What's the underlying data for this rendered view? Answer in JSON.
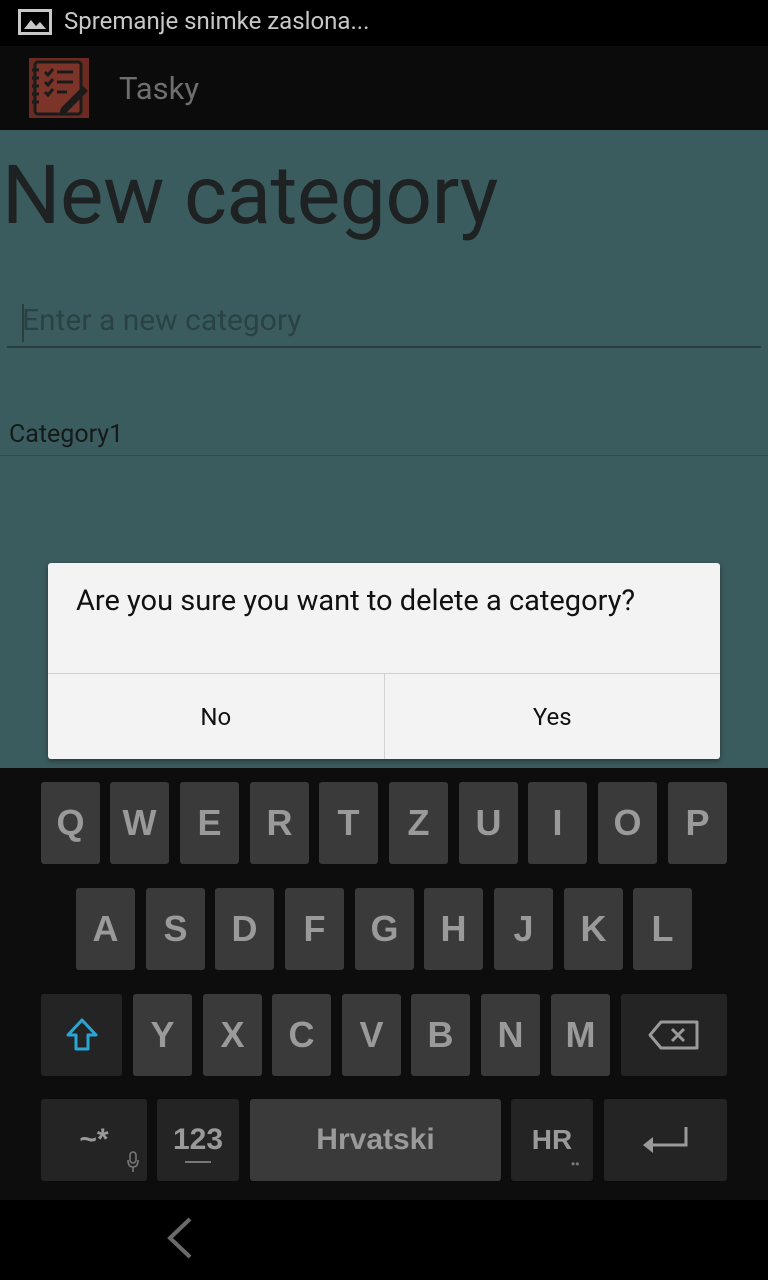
{
  "status_bar": {
    "notification_text": "Spremanje snimke zaslona..."
  },
  "action_bar": {
    "app_title": "Tasky"
  },
  "page": {
    "heading": "New category",
    "category_input": {
      "placeholder": "Enter a new category",
      "value": ""
    },
    "categories": [
      "Category1"
    ]
  },
  "dialog": {
    "message": "Are you sure you want to delete a category?",
    "no_label": "No",
    "yes_label": "Yes"
  },
  "keyboard": {
    "row1": [
      "Q",
      "W",
      "E",
      "R",
      "T",
      "Z",
      "U",
      "I",
      "O",
      "P"
    ],
    "row2": [
      "A",
      "S",
      "D",
      "F",
      "G",
      "H",
      "J",
      "K",
      "L"
    ],
    "row3": [
      "Y",
      "X",
      "C",
      "V",
      "B",
      "N",
      "M"
    ],
    "symbols_label": "~*",
    "numbers_label": "123",
    "space_label": "Hrvatski",
    "language_label": "HR"
  },
  "icons": {
    "status": "image-icon",
    "app": "notebook-checklist-icon",
    "shift": "shift-arrow-icon",
    "backspace": "backspace-icon",
    "enter": "enter-icon",
    "mic": "mic-icon",
    "back": "back-chevron-icon"
  },
  "colors": {
    "content_bg": "#3b5c5e",
    "dialog_bg": "#f3f3f3",
    "key_bg": "#3a3a3a",
    "shift_accent": "#2aa6d6"
  }
}
